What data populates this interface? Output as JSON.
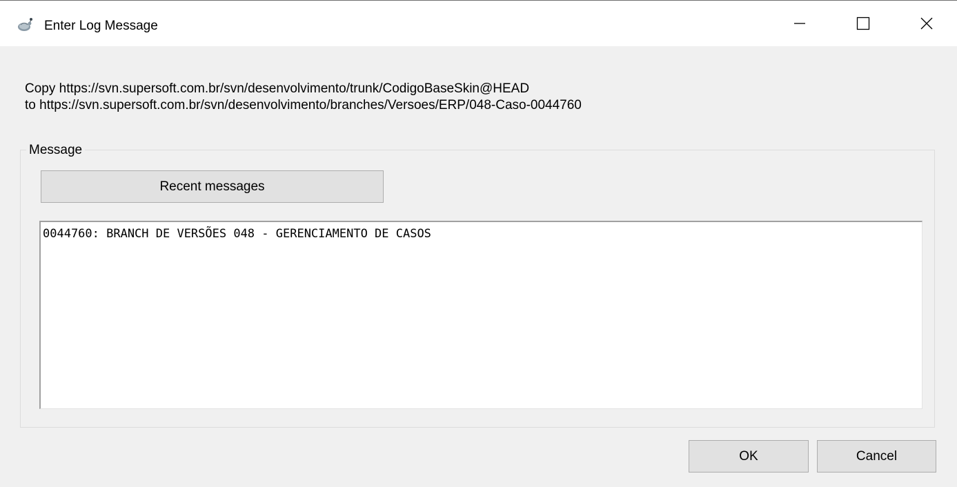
{
  "window": {
    "title": "Enter Log Message",
    "icon": "tortoise-svn-icon",
    "controls": {
      "minimize": "minimize-icon",
      "maximize": "maximize-icon",
      "close": "close-icon"
    }
  },
  "info": {
    "line1": "Copy https://svn.supersoft.com.br/svn/desenvolvimento/trunk/CodigoBaseSkin@HEAD",
    "line2": "to https://svn.supersoft.com.br/svn/desenvolvimento/branches/Versoes/ERP/048-Caso-0044760"
  },
  "message_group": {
    "legend": "Message",
    "recent_button": "Recent messages",
    "text": "0044760: BRANCH DE VERSÕES 048 - GERENCIAMENTO DE CASOS"
  },
  "buttons": {
    "ok": "OK",
    "cancel": "Cancel"
  }
}
